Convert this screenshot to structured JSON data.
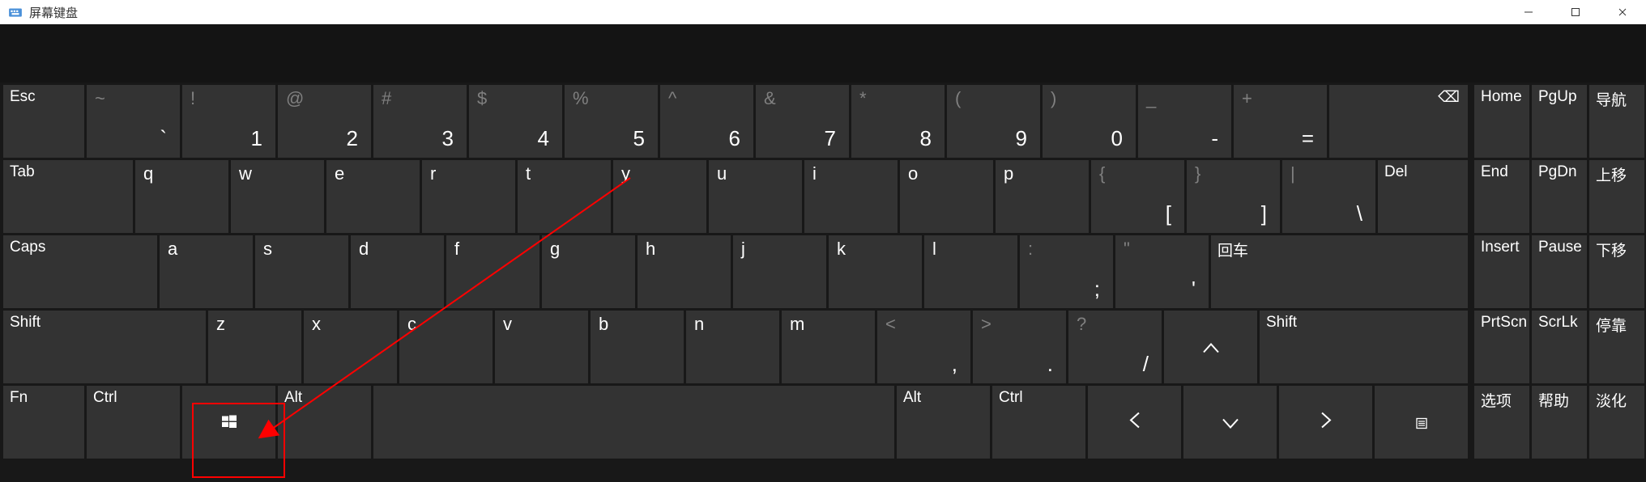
{
  "window": {
    "title": "屏幕键盘",
    "minimize": "—",
    "maximize": "□",
    "close": "✕"
  },
  "rows": {
    "r1": {
      "esc": "Esc",
      "k1": {
        "s": "~",
        "m": "`"
      },
      "k2": {
        "s": "!",
        "m": "1"
      },
      "k3": {
        "s": "@",
        "m": "2"
      },
      "k4": {
        "s": "#",
        "m": "3"
      },
      "k5": {
        "s": "$",
        "m": "4"
      },
      "k6": {
        "s": "%",
        "m": "5"
      },
      "k7": {
        "s": "^",
        "m": "6"
      },
      "k8": {
        "s": "&",
        "m": "7"
      },
      "k9": {
        "s": "*",
        "m": "8"
      },
      "k10": {
        "s": "(",
        "m": "9"
      },
      "k11": {
        "s": ")",
        "m": "0"
      },
      "k12": {
        "s": "_",
        "m": "-"
      },
      "k13": {
        "s": "+",
        "m": "="
      },
      "bksp": "⌫"
    },
    "r2": {
      "tab": "Tab",
      "q": "q",
      "w": "w",
      "e": "e",
      "r": "r",
      "t": "t",
      "y": "y",
      "u": "u",
      "i": "i",
      "o": "o",
      "p": "p",
      "lb": {
        "s": "{",
        "m": "["
      },
      "rb": {
        "s": "}",
        "m": "]"
      },
      "bs": {
        "s": "|",
        "m": "\\"
      },
      "del": "Del"
    },
    "r3": {
      "caps": "Caps",
      "a": "a",
      "s": "s",
      "d": "d",
      "f": "f",
      "g": "g",
      "h": "h",
      "j": "j",
      "k": "k",
      "l": "l",
      "sc": {
        "s": ":",
        "m": ";"
      },
      "ap": {
        "s": "\"",
        "m": "'"
      },
      "enter": "回车"
    },
    "r4": {
      "shift": "Shift",
      "z": "z",
      "x": "x",
      "c": "c",
      "v": "v",
      "b": "b",
      "n": "n",
      "m": "m",
      "cm": {
        "s": "<",
        "m": ","
      },
      "pd": {
        "s": ">",
        "m": "."
      },
      "sl": {
        "s": "?",
        "m": "/"
      },
      "up": "∧",
      "shift2": "Shift"
    },
    "r5": {
      "fn": "Fn",
      "ctrl": "Ctrl",
      "win": "",
      "alt": "Alt",
      "space": "",
      "alt2": "Alt",
      "ctrl2": "Ctrl",
      "left": "〈",
      "down": "∨",
      "right": "〉",
      "menu": ""
    }
  },
  "side": {
    "r1": {
      "a": "Home",
      "b": "PgUp",
      "c": "导航"
    },
    "r2": {
      "a": "End",
      "b": "PgDn",
      "c": "上移"
    },
    "r3": {
      "a": "Insert",
      "b": "Pause",
      "c": "下移"
    },
    "r4": {
      "a": "PrtScn",
      "b": "ScrLk",
      "c": "停靠"
    },
    "r5": {
      "a": "选项",
      "b": "帮助",
      "c": "淡化"
    }
  },
  "colors": {
    "accent": "#ff0000"
  }
}
